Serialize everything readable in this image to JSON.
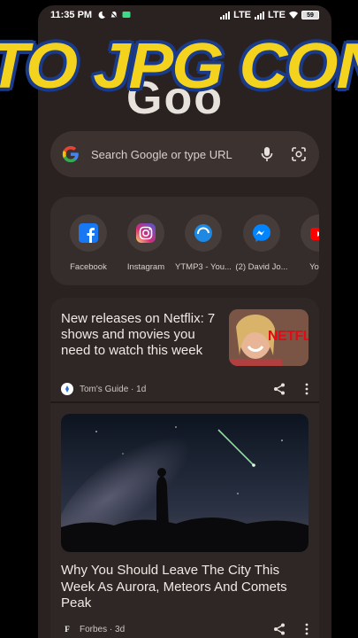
{
  "status_bar": {
    "time": "11:35 PM",
    "network_1": "LTE",
    "network_2": "LTE",
    "battery": "59"
  },
  "overlay_banner": {
    "text": "TO JPG CONV"
  },
  "google": {
    "logo_text": "Goo"
  },
  "search": {
    "placeholder": "Search Google or type URL"
  },
  "shortcuts": [
    {
      "label": "Facebook",
      "icon": "facebook-icon"
    },
    {
      "label": "Instagram",
      "icon": "instagram-icon"
    },
    {
      "label": "YTMP3 - You...",
      "icon": "ytmp3-icon"
    },
    {
      "label": "(2) David Jo...",
      "icon": "messenger-icon"
    },
    {
      "label": "YouT",
      "icon": "youtube-icon"
    }
  ],
  "feed": {
    "articles": [
      {
        "title": "New releases on Netflix: 7 shows and movies you need to watch this week",
        "source": "Tom's Guide · 1d",
        "thumb_text": "NETFL"
      },
      {
        "title": "Why You Should Leave The City This Week As Aurora, Meteors And Comets Peak",
        "source": "Forbes · 3d",
        "source_logo": "F"
      }
    ]
  },
  "colors": {
    "background": "#2a2220",
    "card": "#352d2b",
    "banner_yellow": "#f4d31e",
    "banner_outline": "#1a3a8a"
  }
}
